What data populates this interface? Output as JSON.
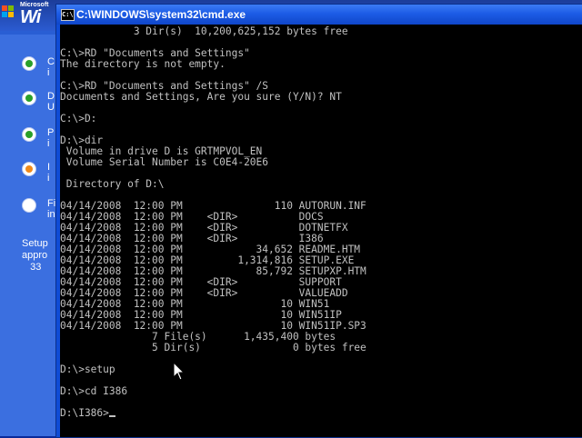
{
  "setup_background": {
    "brand_small": "Microsoft",
    "brand_large": "Wi",
    "steps": [
      {
        "label": "C\ni",
        "state": "done"
      },
      {
        "label": "D\nU",
        "state": "done"
      },
      {
        "label": "P\ni",
        "state": "done"
      },
      {
        "label": "I\ni",
        "state": "current"
      },
      {
        "label": "Fi\nin",
        "state": "pending"
      }
    ],
    "note": "Setup\nappro\n   33"
  },
  "cmd_window": {
    "title": "C:\\WINDOWS\\system32\\cmd.exe",
    "icon_text": "C:\\",
    "console_lines": [
      "            3 Dir(s)  10,200,625,152 bytes free",
      "",
      "C:\\>RD \"Documents and Settings\"",
      "The directory is not empty.",
      "",
      "C:\\>RD \"Documents and Settings\" /S",
      "Documents and Settings, Are you sure (Y/N)? NT",
      "",
      "C:\\>D:",
      "",
      "D:\\>dir",
      " Volume in drive D is GRTMPVOL_EN",
      " Volume Serial Number is C0E4-20E6",
      "",
      " Directory of D:\\",
      "",
      "04/14/2008  12:00 PM               110 AUTORUN.INF",
      "04/14/2008  12:00 PM    <DIR>          DOCS",
      "04/14/2008  12:00 PM    <DIR>          DOTNETFX",
      "04/14/2008  12:00 PM    <DIR>          I386",
      "04/14/2008  12:00 PM            34,652 README.HTM",
      "04/14/2008  12:00 PM         1,314,816 SETUP.EXE",
      "04/14/2008  12:00 PM            85,792 SETUPXP.HTM",
      "04/14/2008  12:00 PM    <DIR>          SUPPORT",
      "04/14/2008  12:00 PM    <DIR>          VALUEADD",
      "04/14/2008  12:00 PM                10 WIN51",
      "04/14/2008  12:00 PM                10 WIN51IP",
      "04/14/2008  12:00 PM                10 WIN51IP.SP3",
      "               7 File(s)      1,435,400 bytes",
      "               5 Dir(s)               0 bytes free",
      "",
      "D:\\>setup",
      "",
      "D:\\>cd I386",
      ""
    ],
    "prompt": "D:\\I386>"
  },
  "colors": {
    "console_text": "#c0c0c0",
    "console_bg": "#000000",
    "titlebar": "#1d5ce6",
    "xp_blue": "#2456c9"
  }
}
